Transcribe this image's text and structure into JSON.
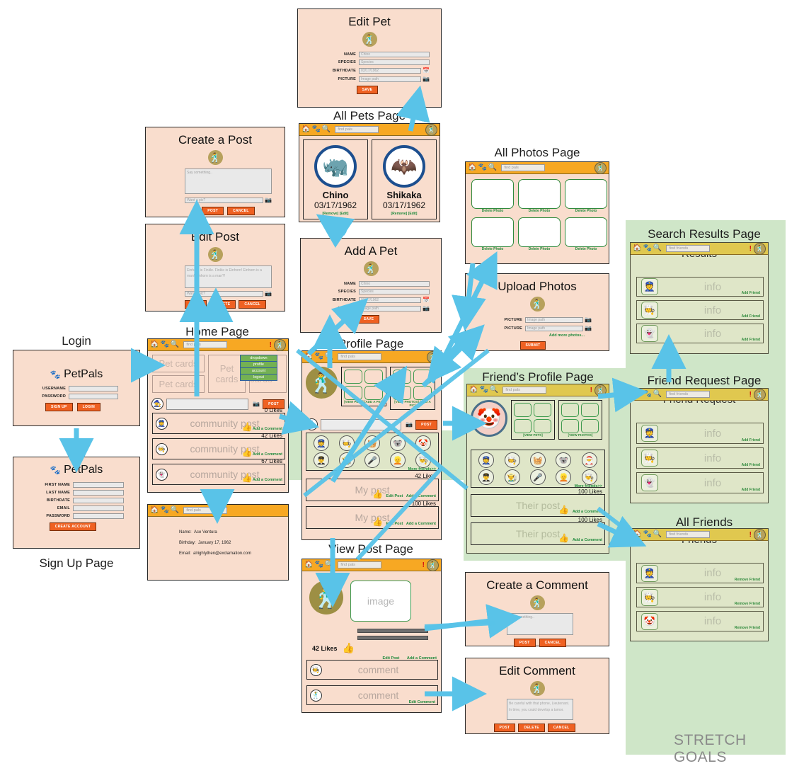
{
  "meta": {
    "stretch_goals_label": "STRETCH GOALS"
  },
  "nav": {
    "home_icon": "home-icon",
    "paw_icon": "paw-icon",
    "search_icon": "magnifier-icon",
    "find_pals_placeholder": "find pals",
    "find_friends_placeholder": "find friends",
    "alert": "!"
  },
  "pages": {
    "login": {
      "caption": "Login",
      "brand": "PetPals",
      "fields": [
        {
          "label": "USERNAME",
          "value": ""
        },
        {
          "label": "PASSWORD",
          "value": ""
        }
      ],
      "buttons": [
        "SIGN UP",
        "LOGIN"
      ]
    },
    "signup": {
      "caption": "Sign Up Page",
      "brand": "PetPals",
      "fields": [
        {
          "label": "FIRST NAME",
          "value": ""
        },
        {
          "label": "LAST NAME",
          "value": ""
        },
        {
          "label": "BIRTHDATE",
          "value": ""
        },
        {
          "label": "EMAIL",
          "value": ""
        },
        {
          "label": "PASSWORD",
          "value": ""
        }
      ],
      "buttons": [
        "CREATE ACCOUNT"
      ]
    },
    "create_post": {
      "caption": "Create a Post",
      "textarea_placeholder": "Say something..",
      "pic_placeholder": "Want a pic?",
      "buttons": [
        "POST",
        "CANCEL"
      ]
    },
    "edit_post": {
      "caption": "Edit Post",
      "textarea_value": "Einhorn is Finkle. Finkle is Einhorn! Einhorn is a man! Einhorn is a man?!",
      "pic_placeholder": "Want a pic?",
      "buttons": [
        "POST",
        "DELETE",
        "CANCEL"
      ]
    },
    "edit_pet": {
      "caption": "Edit Pet",
      "fields": [
        {
          "label": "NAME",
          "value": "Chino"
        },
        {
          "label": "SPECIES",
          "value": "Species"
        },
        {
          "label": "BIRTHDATE",
          "value": "03/17/1962"
        },
        {
          "label": "PICTURE",
          "value": "Image path"
        }
      ],
      "buttons": [
        "SAVE"
      ]
    },
    "add_pet": {
      "caption": "Add A Pet",
      "fields": [
        {
          "label": "NAME",
          "value": "Chino"
        },
        {
          "label": "SPECIES",
          "value": "Species"
        },
        {
          "label": "BIRTHDATE",
          "value": "03/17/1962"
        },
        {
          "label": "PICTURE",
          "value": "Image path"
        }
      ],
      "buttons": [
        "SAVE"
      ]
    },
    "all_pets": {
      "caption": "All Pets Page",
      "pets": [
        {
          "name": "Chino",
          "birthdate": "03/17/1962",
          "links": "[Remove] [Edit]",
          "icon": "rhinoceros-icon",
          "glyph": "🦏"
        },
        {
          "name": "Shikaka",
          "birthdate": "03/17/1962",
          "links": "[Remove] [Edit]",
          "icon": "bat-icon",
          "glyph": "🦇"
        }
      ]
    },
    "all_photos": {
      "caption": "All Photos Page",
      "delete_label": "Delete Photo",
      "cells": 6
    },
    "upload_photos": {
      "caption": "Upload Photos",
      "fields": [
        {
          "label": "PICTURE",
          "value": "Image path"
        },
        {
          "label": "PICTURE",
          "value": "Image path"
        }
      ],
      "add_more": "Add more photos...",
      "buttons": [
        "SUBMIT"
      ]
    },
    "home": {
      "caption": "Home Page",
      "pet_cards": [
        "Pet cards",
        "Pet cards",
        "Pet cards",
        "Pet cards"
      ],
      "dropdown": [
        "dropdown",
        "profile",
        "account",
        "logout"
      ],
      "post_button": "POST",
      "posts": [
        {
          "text": "community post",
          "likes": "0 Likes",
          "comment_link": "Add a Comment",
          "icon": "police-officer-icon",
          "glyph": "👮"
        },
        {
          "text": "community post",
          "likes": "42 Likes",
          "comment_link": "Add a Comment",
          "icon": "cook-icon",
          "glyph": "🧑‍🍳"
        },
        {
          "text": "community post",
          "likes": "67 Likes",
          "comment_link": "Add a Comment",
          "icon": "ghost-icon",
          "glyph": "👻"
        }
      ]
    },
    "profile_info": {
      "rows": [
        {
          "label": "Name:",
          "value": "Ace Ventura"
        },
        {
          "label": "Birthday:",
          "value": "January 17, 1962"
        },
        {
          "label": "Email:",
          "value": "alrightythen@exclamation.com"
        }
      ]
    },
    "profile": {
      "caption": "Profile Page",
      "pets_links": "[VIEW PETS] [ADD A PET]",
      "photos_links": "[VIEW PHOTOS] [ADD A PIC]",
      "more_friends": "More friends>>",
      "post_button": "POST",
      "posts": [
        {
          "text": "My post",
          "likes": "42 Likes",
          "edit_link": "Edit Post",
          "comment_link": "Add a Comment"
        },
        {
          "text": "My post",
          "likes": "100 Likes",
          "edit_link": "Edit Post",
          "comment_link": "Add a Comment"
        }
      ]
    },
    "friend_profile": {
      "caption": "Friend’s Profile Page",
      "pets_links": "[VIEW PETS]",
      "photos_links": "[VIEW PHOTOS]",
      "more_friends": "More friends>>",
      "avatar_icon": "clown-face-icon",
      "posts": [
        {
          "text": "Their post",
          "likes": "100 Likes",
          "comment_link": "Add a Comment"
        },
        {
          "text": "Their post",
          "likes": "100 Likes",
          "comment_link": "Add a Comment"
        }
      ]
    },
    "view_post": {
      "caption": "View Post Page",
      "image_label": "image",
      "likes": "42 Likes",
      "edit_link": "Edit Post",
      "comment_link": "Add a Comment",
      "comments": [
        {
          "text": "comment",
          "icon": "cook-icon",
          "glyph": "🧑‍🍳",
          "edit_link": ""
        },
        {
          "text": "comment",
          "icon": "ace-avatar-icon",
          "glyph": "🕺",
          "edit_link": "Edit Comment"
        }
      ]
    },
    "create_comment": {
      "caption": "Create a Comment",
      "textarea_placeholder": "Say something..",
      "buttons": [
        "POST",
        "CANCEL"
      ]
    },
    "edit_comment": {
      "caption": "Edit Comment",
      "textarea_value": "Be careful with that phone, Lieutenant. In time, you could develop a tumor.",
      "buttons": [
        "POST",
        "DELETE",
        "CANCEL"
      ]
    },
    "search_results": {
      "caption": "Search Results Page",
      "title": "Results",
      "rows": [
        {
          "info": "info",
          "action": "Add Friend",
          "icon": "police-officer-icon",
          "glyph": "👮"
        },
        {
          "info": "info",
          "action": "Add Friend",
          "icon": "cook-icon",
          "glyph": "🧑‍🍳"
        },
        {
          "info": "info",
          "action": "Add Friend",
          "icon": "ghost-icon",
          "glyph": "👻"
        }
      ]
    },
    "friend_request": {
      "caption": "Friend Request Page",
      "title": "Friend Request",
      "rows": [
        {
          "info": "info",
          "action": "Add Friend",
          "icon": "police-officer-icon",
          "glyph": "👮"
        },
        {
          "info": "info",
          "action": "Add Friend",
          "icon": "cook-icon",
          "glyph": "🧑‍🍳"
        },
        {
          "info": "info",
          "action": "Add Friend",
          "icon": "ghost-icon",
          "glyph": "👻"
        }
      ]
    },
    "all_friends": {
      "caption": "All Friends",
      "title": "Friends",
      "rows": [
        {
          "info": "info",
          "action": "Remove Friend",
          "icon": "police-officer-icon",
          "glyph": "👮"
        },
        {
          "info": "info",
          "action": "Remove Friend",
          "icon": "cook-icon",
          "glyph": "🧑‍🍳"
        },
        {
          "info": "info",
          "action": "Remove Friend",
          "icon": "clown-face-icon",
          "glyph": "🤡"
        }
      ]
    }
  },
  "colors": {
    "panel_bg": "#f9ddcd",
    "green_panel_bg": "#dfe6c8",
    "stretch_bg": "#cfe6c8",
    "nav_orange": "#f7a823",
    "nav_olive": "#e0c84f",
    "button_orange": "#ef6122",
    "link_green": "#1f8a3c",
    "arrow_blue": "#59c3e8"
  }
}
